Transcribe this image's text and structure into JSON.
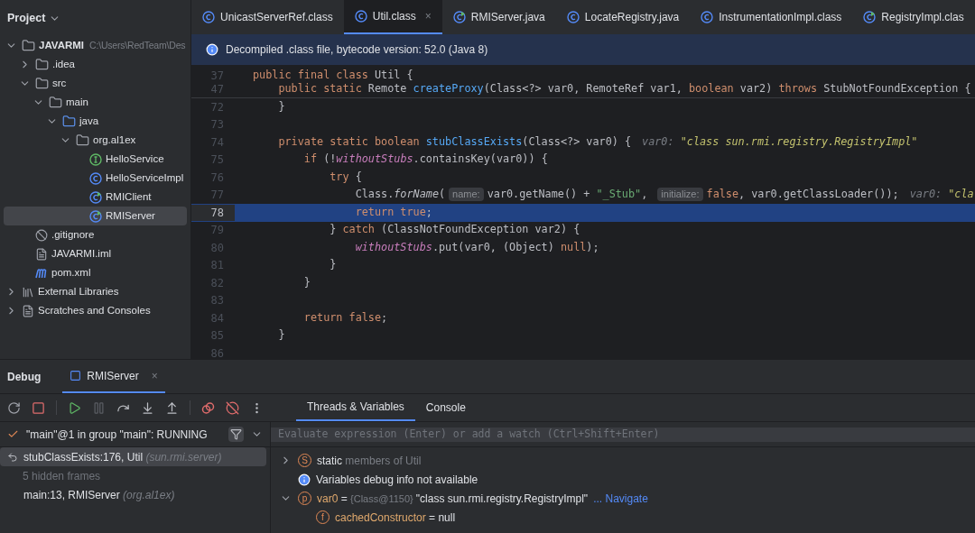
{
  "project": {
    "title": "Project",
    "tree": [
      {
        "label": "JAVARMI",
        "path": "C:\\Users\\RedTeam\\Des",
        "kind": "module",
        "expanded": true,
        "selected": false,
        "children": [
          {
            "label": ".idea",
            "kind": "folder",
            "expanded": false,
            "selected": false
          },
          {
            "label": "src",
            "kind": "folder",
            "expanded": true,
            "selected": false,
            "children": [
              {
                "label": "main",
                "kind": "folder",
                "expanded": true,
                "selected": false,
                "children": [
                  {
                    "label": "java",
                    "kind": "source",
                    "expanded": true,
                    "selected": false,
                    "children": [
                      {
                        "label": "org.al1ex",
                        "kind": "package",
                        "expanded": true,
                        "selected": false,
                        "children": [
                          {
                            "label": "HelloService",
                            "kind": "interface",
                            "selected": false
                          },
                          {
                            "label": "HelloServiceImpl",
                            "kind": "class",
                            "selected": false
                          },
                          {
                            "label": "RMIClient",
                            "kind": "runclass",
                            "selected": false
                          },
                          {
                            "label": "RMIServer",
                            "kind": "runclass",
                            "selected": true
                          }
                        ]
                      }
                    ]
                  }
                ]
              }
            ]
          },
          {
            "label": ".gitignore",
            "kind": "ignore",
            "selected": false
          },
          {
            "label": "JAVARMI.iml",
            "kind": "file",
            "selected": false
          },
          {
            "label": "pom.xml",
            "kind": "maven",
            "selected": false
          }
        ]
      },
      {
        "label": "External Libraries",
        "kind": "library",
        "expanded": false,
        "selected": false
      },
      {
        "label": "Scratches and Consoles",
        "kind": "scratch",
        "expanded": false,
        "selected": false
      }
    ]
  },
  "tabs": [
    {
      "label": "UnicastServerRef.class",
      "kind": "class",
      "selected": false
    },
    {
      "label": "Util.class",
      "kind": "class",
      "selected": true,
      "close": "×"
    },
    {
      "label": "RMIServer.java",
      "kind": "runclass",
      "selected": false
    },
    {
      "label": "LocateRegistry.java",
      "kind": "class",
      "selected": false
    },
    {
      "label": "InstrumentationImpl.class",
      "kind": "class",
      "selected": false
    },
    {
      "label": "RegistryImpl.clas",
      "kind": "runclass",
      "selected": false
    }
  ],
  "banner": "Decompiled .class file, bytecode version: 52.0 (Java 8)",
  "sticky_lines": [
    {
      "number": "37",
      "tokens": [
        {
          "kind": "kw",
          "text": "public final class "
        },
        {
          "kind": "plain",
          "text": "Util {"
        }
      ]
    },
    {
      "number": "47",
      "tokens": [
        {
          "kind": "kw",
          "text": "    public static "
        },
        {
          "kind": "plain",
          "text": "Remote "
        },
        {
          "kind": "fn",
          "text": "createProxy"
        },
        {
          "kind": "plain",
          "text": "(Class<?> var0, RemoteRef var1, "
        },
        {
          "kind": "kw",
          "text": "boolean "
        },
        {
          "kind": "plain",
          "text": "var2) "
        },
        {
          "kind": "kw",
          "text": "throws "
        },
        {
          "kind": "plain",
          "text": "StubNotFoundException {"
        }
      ]
    }
  ],
  "code": [
    {
      "number": "72",
      "highlighted": false,
      "tokens": [
        {
          "kind": "plain",
          "text": "    }"
        }
      ]
    },
    {
      "number": "73",
      "highlighted": false
    },
    {
      "number": "74",
      "highlighted": false,
      "tokens": [
        {
          "kind": "kw",
          "text": "    private static boolean "
        },
        {
          "kind": "fn",
          "text": "stubClassExists"
        },
        {
          "kind": "plain",
          "text": "(Class<?> var0) {"
        },
        {
          "kind": "value",
          "text": "var0: ",
          "value": "\"class sun.rmi.registry.RegistryImpl\""
        }
      ]
    },
    {
      "number": "75",
      "highlighted": false,
      "tokens": [
        {
          "kind": "kw",
          "text": "        if "
        },
        {
          "kind": "plain",
          "text": "(!"
        },
        {
          "kind": "field",
          "text": "withoutStubs"
        },
        {
          "kind": "plain",
          "text": ".containsKey(var0)) {"
        }
      ]
    },
    {
      "number": "76",
      "highlighted": false,
      "tokens": [
        {
          "kind": "kw",
          "text": "            try "
        },
        {
          "kind": "plain",
          "text": "{"
        }
      ]
    },
    {
      "number": "77",
      "highlighted": false,
      "tokens": [
        {
          "kind": "plain",
          "text": "                Class."
        },
        {
          "kind": "static",
          "text": "forName"
        },
        {
          "kind": "plain",
          "text": "("
        },
        {
          "kind": "hint",
          "text": "name:"
        },
        {
          "kind": "plain",
          "text": "var0.getName() + "
        },
        {
          "kind": "str",
          "text": "\"_Stub\""
        },
        {
          "kind": "plain",
          "text": ", "
        },
        {
          "kind": "hint",
          "text": "initialize:"
        },
        {
          "kind": "kw",
          "text": "false"
        },
        {
          "kind": "plain",
          "text": ", var0.getClassLoader());"
        },
        {
          "kind": "value",
          "text": "var0: ",
          "value": "\"cla"
        }
      ]
    },
    {
      "number": "78",
      "highlighted": true,
      "tokens": [
        {
          "kind": "kw",
          "text": "                return true"
        },
        {
          "kind": "plain",
          "text": ";"
        }
      ]
    },
    {
      "number": "79",
      "highlighted": false,
      "tokens": [
        {
          "kind": "plain",
          "text": "            } "
        },
        {
          "kind": "kw",
          "text": "catch "
        },
        {
          "kind": "plain",
          "text": "(ClassNotFoundException var2) {"
        }
      ]
    },
    {
      "number": "80",
      "highlighted": false,
      "tokens": [
        {
          "kind": "field",
          "text": "                withoutStubs"
        },
        {
          "kind": "plain",
          "text": ".put(var0, (Object) "
        },
        {
          "kind": "kw",
          "text": "null"
        },
        {
          "kind": "plain",
          "text": ");"
        }
      ]
    },
    {
      "number": "81",
      "highlighted": false,
      "tokens": [
        {
          "kind": "plain",
          "text": "            }"
        }
      ]
    },
    {
      "number": "82",
      "highlighted": false,
      "tokens": [
        {
          "kind": "plain",
          "text": "        }"
        }
      ]
    },
    {
      "number": "83",
      "highlighted": false
    },
    {
      "number": "84",
      "highlighted": false,
      "tokens": [
        {
          "kind": "kw",
          "text": "        return false"
        },
        {
          "kind": "plain",
          "text": ";"
        }
      ]
    },
    {
      "number": "85",
      "highlighted": false,
      "tokens": [
        {
          "kind": "plain",
          "text": "    }"
        }
      ]
    },
    {
      "number": "86",
      "highlighted": false
    }
  ],
  "debug": {
    "title": "Debug",
    "session": {
      "label": "RMIServer",
      "close": "×",
      "selected": true
    },
    "tabs": [
      {
        "label": "Threads & Variables",
        "selected": true
      },
      {
        "label": "Console",
        "selected": false
      }
    ],
    "thread": "\"main\"@1 in group \"main\": RUNNING",
    "frames": [
      {
        "kind": "frame",
        "method": "stubClassExists:176, Util",
        "package": "(sun.rmi.server)",
        "selected": true
      },
      {
        "kind": "hidden",
        "method": "5 hidden frames",
        "selected": false
      },
      {
        "kind": "frame",
        "method": "main:13, RMIServer",
        "package": "(org.al1ex)",
        "selected": false
      }
    ],
    "evaluate": {
      "placeholder": "Evaluate expression (Enter) or add a watch (Ctrl+Shift+Enter)"
    },
    "variables": [
      {
        "kind": "static",
        "badge": "S",
        "name": "static",
        "value": "members of Util",
        "expanded": false
      },
      {
        "kind": "info",
        "name": "Variables debug info not available"
      },
      {
        "kind": "param",
        "badge": "p",
        "name": "var0",
        "operator": "=",
        "type": "{Class@1150}",
        "value": "\"class sun.rmi.registry.RegistryImpl\"",
        "link": "... Navigate",
        "expanded": true,
        "children": [
          {
            "kind": "field",
            "badge": "f",
            "name": "cachedConstructor",
            "operator": "=",
            "value": "null"
          }
        ]
      }
    ]
  }
}
